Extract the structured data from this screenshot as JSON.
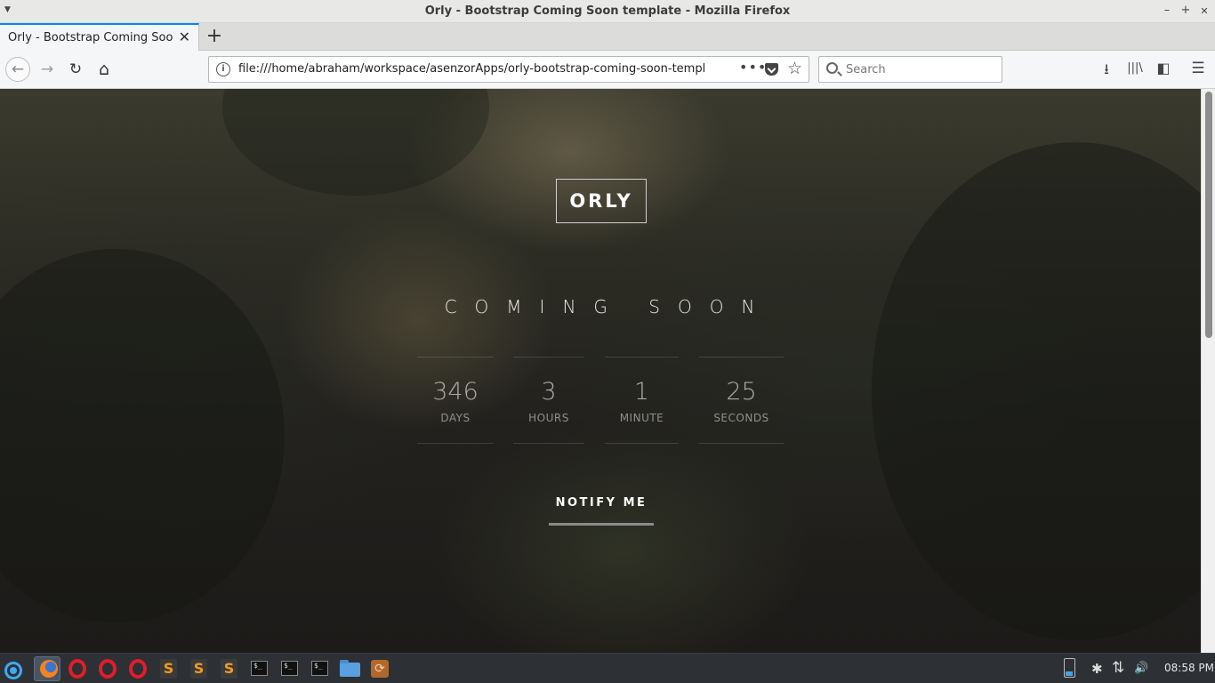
{
  "window": {
    "title": "Orly - Bootstrap Coming Soon template - Mozilla Firefox",
    "minimize": "–",
    "maximize": "+",
    "close": "✕"
  },
  "tabs": [
    {
      "label": "Orly - Bootstrap Coming Soon t",
      "close": "✕",
      "active": true
    }
  ],
  "new_tab": "+",
  "nav": {
    "back": "←",
    "forward": "→",
    "reload": "↻",
    "home": "⌂",
    "url": "file:///home/abraham/workspace/asenzorApps/orly-bootstrap-coming-soon-template/i",
    "page_actions": "•••",
    "bookmark_star": "☆",
    "search_placeholder": "Search",
    "downloads": "⭳",
    "library": "|||\\",
    "sidebar": "◧",
    "menu": "☰"
  },
  "page": {
    "logo": "ORLY",
    "heading": "COMING SOON",
    "countdown": [
      {
        "value": "346",
        "unit": "DAYS"
      },
      {
        "value": "3",
        "unit": "HOURS"
      },
      {
        "value": "1",
        "unit": "MINUTE"
      },
      {
        "value": "25",
        "unit": "SECONDS"
      }
    ],
    "notify_label": "NOTIFY ME"
  },
  "taskbar": {
    "apps": [
      "app-menu",
      "firefox",
      "opera",
      "opera",
      "opera",
      "sublime-text",
      "sublime-text",
      "sublime-text",
      "terminal",
      "terminal",
      "terminal",
      "file-manager",
      "sync"
    ],
    "sublime_glyph": "S",
    "terminal_glyph": "$_",
    "sync_glyph": "⟳",
    "tray_bluetooth": "✱",
    "tray_network": "⇅",
    "tray_volume": "🔊",
    "clock": "08:58 PM"
  },
  "colors": {
    "accent": "#0a84ff",
    "opera_red": "#e21c2a",
    "sublime_orange": "#f49b1c",
    "taskbar_bg": "#2d3034"
  }
}
